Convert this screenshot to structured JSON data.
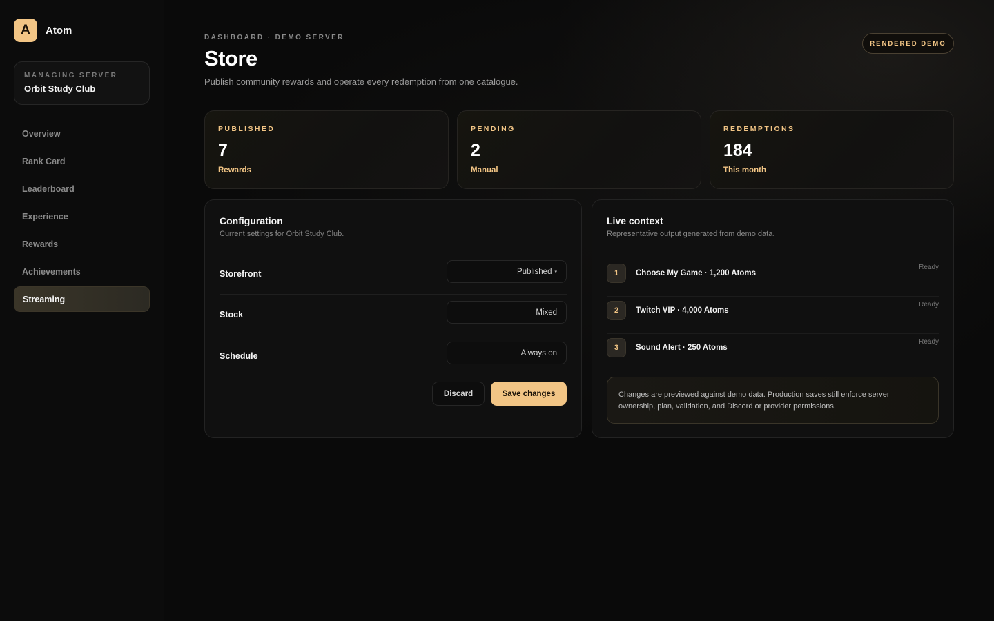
{
  "brand": {
    "logo_letter": "A",
    "name": "Atom"
  },
  "server": {
    "label": "MANAGING SERVER",
    "name": "Orbit Study Club"
  },
  "nav": {
    "items": [
      {
        "label": "Overview"
      },
      {
        "label": "Rank Card"
      },
      {
        "label": "Leaderboard"
      },
      {
        "label": "Experience"
      },
      {
        "label": "Rewards"
      },
      {
        "label": "Achievements"
      },
      {
        "label": "Streaming"
      }
    ],
    "active": "Streaming"
  },
  "header": {
    "breadcrumb": "DASHBOARD · DEMO SERVER",
    "title": "Store",
    "subtitle": "Publish community rewards and operate every redemption from one catalogue.",
    "badge": "RENDERED DEMO"
  },
  "stats": [
    {
      "label": "PUBLISHED",
      "value": "7",
      "sub": "Rewards"
    },
    {
      "label": "PENDING",
      "value": "2",
      "sub": "Manual"
    },
    {
      "label": "REDEMPTIONS",
      "value": "184",
      "sub": "This month"
    }
  ],
  "configuration": {
    "title": "Configuration",
    "subtitle": "Current settings for Orbit Study Club.",
    "rows": [
      {
        "label": "Storefront",
        "value": "Published",
        "dropdown": true
      },
      {
        "label": "Stock",
        "value": "Mixed"
      },
      {
        "label": "Schedule",
        "value": "Always on"
      }
    ],
    "discard_label": "Discard",
    "save_label": "Save changes"
  },
  "live_context": {
    "title": "Live context",
    "subtitle": "Representative output generated from demo data.",
    "items": [
      {
        "num": "1",
        "text": "Choose My Game · 1,200 Atoms",
        "status": "Ready"
      },
      {
        "num": "2",
        "text": "Twitch VIP · 4,000 Atoms",
        "status": "Ready"
      },
      {
        "num": "3",
        "text": "Sound Alert · 250 Atoms",
        "status": "Ready"
      }
    ],
    "notice": "Changes are previewed against demo data. Production saves still enforce server ownership, plan, validation, and Discord or provider permissions."
  },
  "colors": {
    "accent": "#f2c585",
    "background": "#0a0a0a",
    "panel": "#101010"
  }
}
